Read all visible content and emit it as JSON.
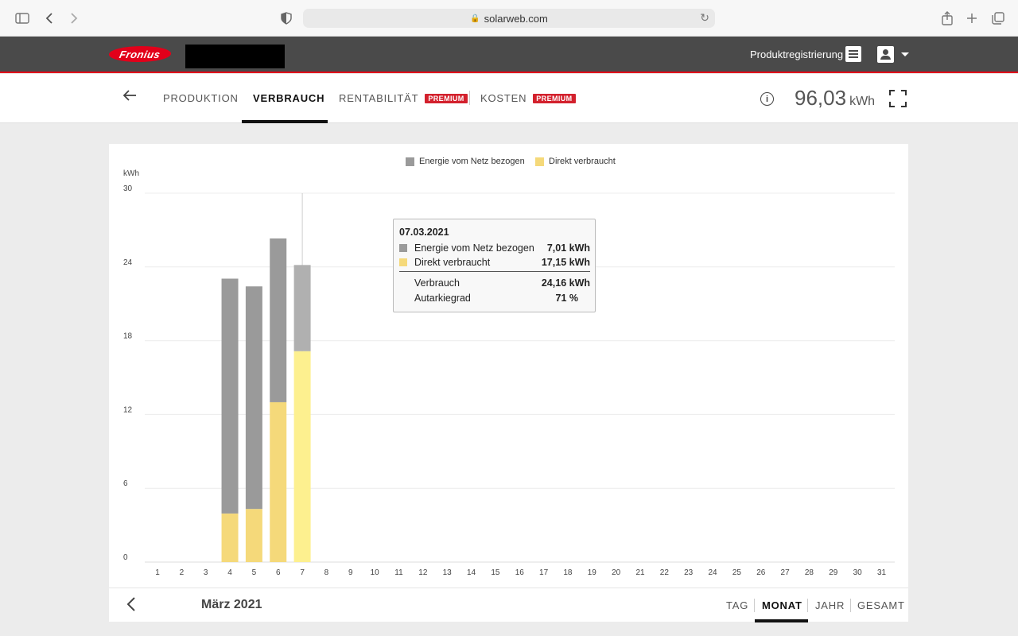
{
  "browser": {
    "url": "solarweb.com",
    "icons": [
      "sidebar-icon",
      "back-icon",
      "forward-icon",
      "shield-icon",
      "lock-icon",
      "reload-icon",
      "share-icon",
      "new-tab-icon",
      "tabs-icon"
    ]
  },
  "header": {
    "logo_text": "Fronius",
    "product_registration": "Produktregistrierung"
  },
  "subnav": {
    "tabs": [
      {
        "label": "PRODUKTION",
        "active": false
      },
      {
        "label": "VERBRAUCH",
        "active": true
      },
      {
        "label": "RENTABILITÄT",
        "badge": "PREMIUM",
        "active": false
      },
      {
        "label": "KOSTEN",
        "badge": "PREMIUM",
        "active": false
      }
    ],
    "total_value": "96,03",
    "total_unit": "kWh"
  },
  "chart_data": {
    "type": "bar",
    "stacked": true,
    "ylabel": "kWh",
    "ylim": [
      0,
      30
    ],
    "yticks": [
      0,
      6,
      12,
      18,
      24,
      30
    ],
    "categories": [
      "1",
      "2",
      "3",
      "4",
      "5",
      "6",
      "7",
      "8",
      "9",
      "10",
      "11",
      "12",
      "13",
      "14",
      "15",
      "16",
      "17",
      "18",
      "19",
      "20",
      "21",
      "22",
      "23",
      "24",
      "25",
      "26",
      "27",
      "28",
      "29",
      "30",
      "31"
    ],
    "legend_position": "top-center",
    "series": [
      {
        "name": "Direkt verbraucht",
        "color": "#f5d97a",
        "values": [
          0,
          0,
          0,
          3.95,
          4.32,
          13.0,
          17.15,
          0,
          0,
          0,
          0,
          0,
          0,
          0,
          0,
          0,
          0,
          0,
          0,
          0,
          0,
          0,
          0,
          0,
          0,
          0,
          0,
          0,
          0,
          0,
          0
        ]
      },
      {
        "name": "Energie vom Netz bezogen",
        "color": "#9a9a9a",
        "values": [
          0,
          0,
          0,
          19.1,
          18.1,
          13.32,
          7.01,
          0,
          0,
          0,
          0,
          0,
          0,
          0,
          0,
          0,
          0,
          0,
          0,
          0,
          0,
          0,
          0,
          0,
          0,
          0,
          0,
          0,
          0,
          0,
          0
        ]
      }
    ],
    "highlight_index": 6,
    "tooltip": {
      "date": "07.03.2021",
      "grid_label": "Energie vom Netz bezogen",
      "grid_value": "7,01 kWh",
      "direct_label": "Direkt verbraucht",
      "direct_value": "17,15 kWh",
      "consumption_label": "Verbrauch",
      "consumption_value": "24,16 kWh",
      "autarky_label": "Autarkiegrad",
      "autarky_value": "71 %"
    }
  },
  "bottom": {
    "month": "März 2021",
    "periods": [
      {
        "label": "TAG",
        "active": false
      },
      {
        "label": "MONAT",
        "active": true
      },
      {
        "label": "JAHR",
        "active": false
      },
      {
        "label": "GESAMT",
        "active": false
      }
    ]
  }
}
